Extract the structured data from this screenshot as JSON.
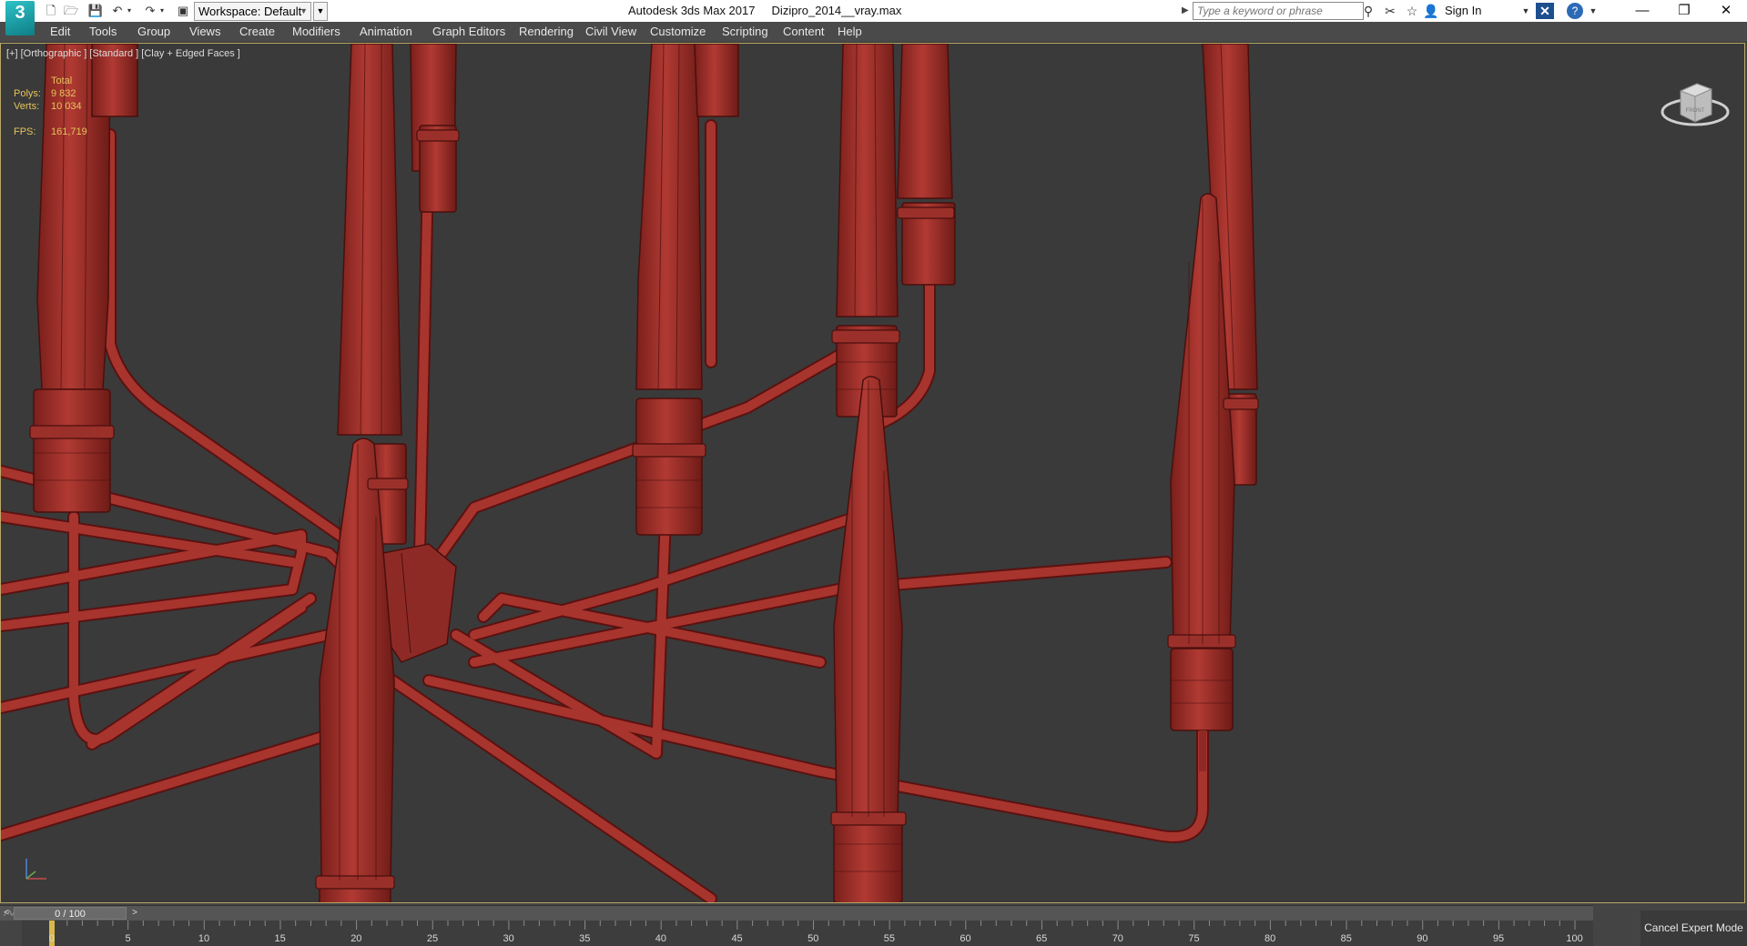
{
  "titlebar": {
    "app_logo": "3",
    "workspace_label": "Workspace: Default",
    "title": "Autodesk 3ds Max 2017     Dizipro_2014__vray.max",
    "search_placeholder": "Type a keyword or phrase",
    "sign_in": "Sign In"
  },
  "menu": [
    "Edit",
    "Tools",
    "Group",
    "Views",
    "Create",
    "Modifiers",
    "Animation",
    "Graph Editors",
    "Rendering",
    "Civil View",
    "Customize",
    "Scripting",
    "Content",
    "Help"
  ],
  "viewport": {
    "label": "[+] [Orthographic ] [Standard ] [Clay + Edged Faces ]",
    "stats": {
      "header": "Total",
      "polys_label": "Polys:",
      "polys_value": "9 832",
      "verts_label": "Verts:",
      "verts_value": "10 034",
      "fps_label": "FPS:",
      "fps_value": "161,719"
    },
    "viewcube_label": "FRONT",
    "colors": {
      "model": "#a8342e",
      "model_edge": "#5a1210",
      "background": "#3a3a3a",
      "border": "#b9a86a"
    }
  },
  "timeline": {
    "slider_value": "0 / 100",
    "prev_label": "<",
    "next_label": ">",
    "ticks": [
      "0",
      "5",
      "10",
      "15",
      "20",
      "25",
      "30",
      "35",
      "40",
      "45",
      "50",
      "55",
      "60",
      "65",
      "70",
      "75",
      "80",
      "85",
      "90",
      "95",
      "100"
    ],
    "current_frame": 0,
    "max_frame": 100
  },
  "expert_mode": {
    "cancel_label": "Cancel Expert Mode"
  },
  "icons": {
    "new": "new-file-icon",
    "open": "open-file-icon",
    "save": "save-icon",
    "undo": "undo-icon",
    "redo": "redo-icon",
    "project": "project-folder-icon",
    "binoculars": "binoculars-icon",
    "exchange": "autodesk-exchange-icon",
    "favorites": "star-icon",
    "user": "user-icon",
    "x": "autodesk-a360-icon",
    "help": "help-icon"
  }
}
